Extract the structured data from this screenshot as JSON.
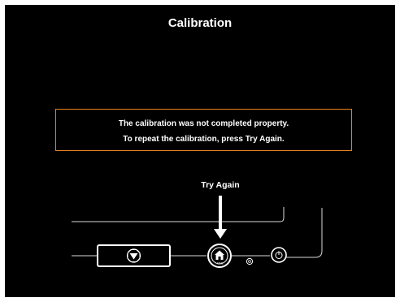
{
  "screen": {
    "title": "Calibration"
  },
  "message": {
    "line1": "The calibration was not completed property.",
    "line2": "To repeat the calibration, press Try Again."
  },
  "hint": {
    "label": "Try Again"
  },
  "panel": {
    "home_label": "HOME"
  },
  "colors": {
    "background": "#000000",
    "text": "#ffffff",
    "message_border": "#e8821e",
    "panel_lines": "#d8d8d8"
  },
  "icons": {
    "stop": "stop-icon",
    "home": "home-icon",
    "copyright": "copyright-icon",
    "power": "power-icon",
    "arrow": "down-arrow-icon"
  }
}
